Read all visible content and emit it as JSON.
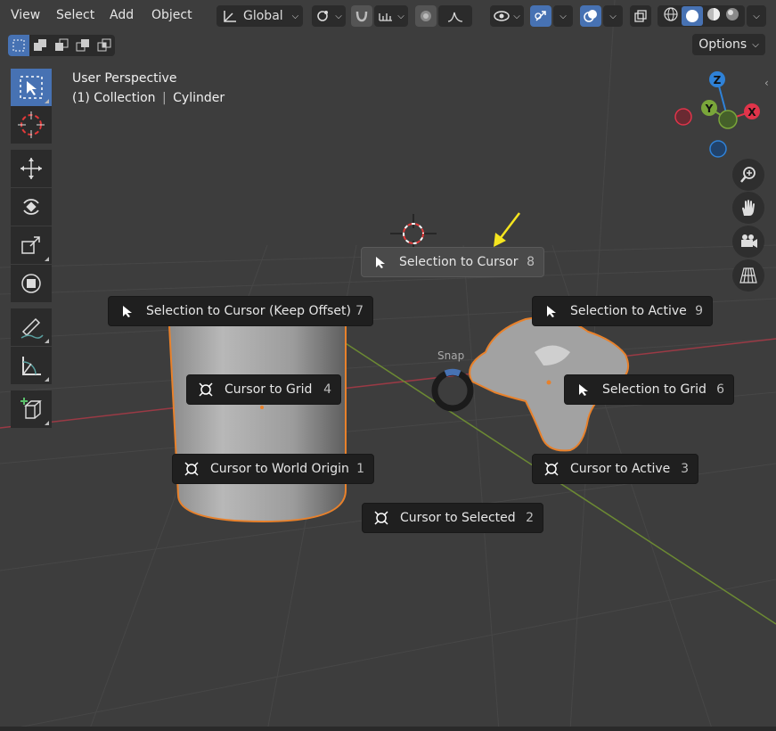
{
  "header": {
    "menus": [
      "View",
      "Select",
      "Add",
      "Object"
    ],
    "transform_orientation": "Global",
    "options_label": "Options"
  },
  "overlay": {
    "view_name": "User Perspective",
    "collection": "(1) Collection",
    "object": "Cylinder"
  },
  "gizmo": {
    "z": "Z",
    "y": "Y",
    "x": "X"
  },
  "pie_menu": {
    "title": "Snap",
    "items": [
      {
        "label": "Selection to Cursor",
        "key": "8"
      },
      {
        "label": "Selection to Cursor (Keep Offset)",
        "key": "7"
      },
      {
        "label": "Selection to Active",
        "key": "9"
      },
      {
        "label": "Cursor to Grid",
        "key": "4"
      },
      {
        "label": "Selection to Grid",
        "key": "6"
      },
      {
        "label": "Cursor to World Origin",
        "key": "1"
      },
      {
        "label": "Cursor to Active",
        "key": "3"
      },
      {
        "label": "Cursor to Selected",
        "key": "2"
      }
    ]
  },
  "colors": {
    "accent": "#4772b3",
    "selection_outline": "#e8812b",
    "x_axis": "#e0344a",
    "y_axis": "#7aa63a",
    "z_axis": "#2f82d8",
    "annotation_arrow": "#f5e51f"
  }
}
